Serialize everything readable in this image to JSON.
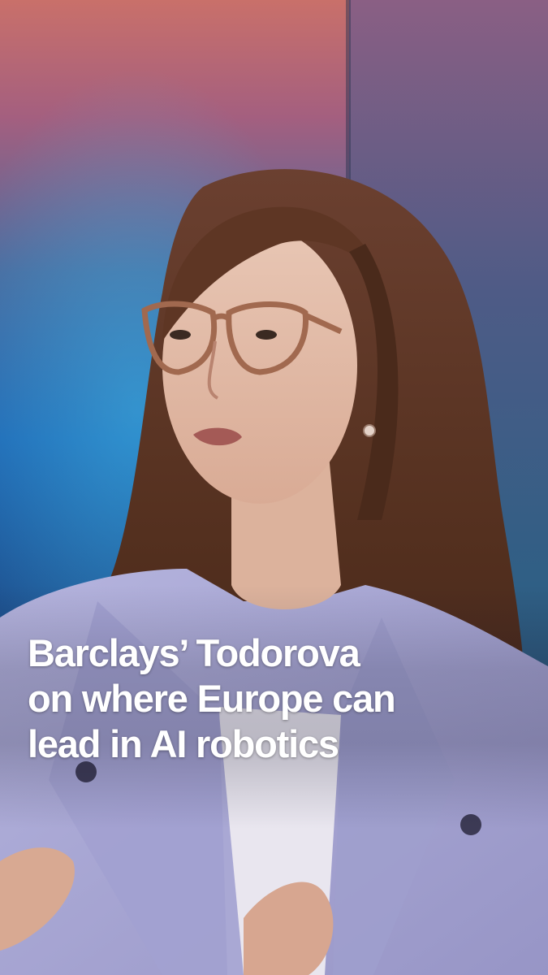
{
  "caption": {
    "lines": [
      "Barclays’ Todorova",
      "on where Europe can",
      "lead in AI robotics"
    ]
  },
  "colors": {
    "backdrop_top": "#c9706a",
    "backdrop_blue": "#1f67b4",
    "backdrop_right": "#36557a",
    "blazer": "#a7a6d3",
    "hair": "#5a3526",
    "caption_text": "#ffffff"
  }
}
